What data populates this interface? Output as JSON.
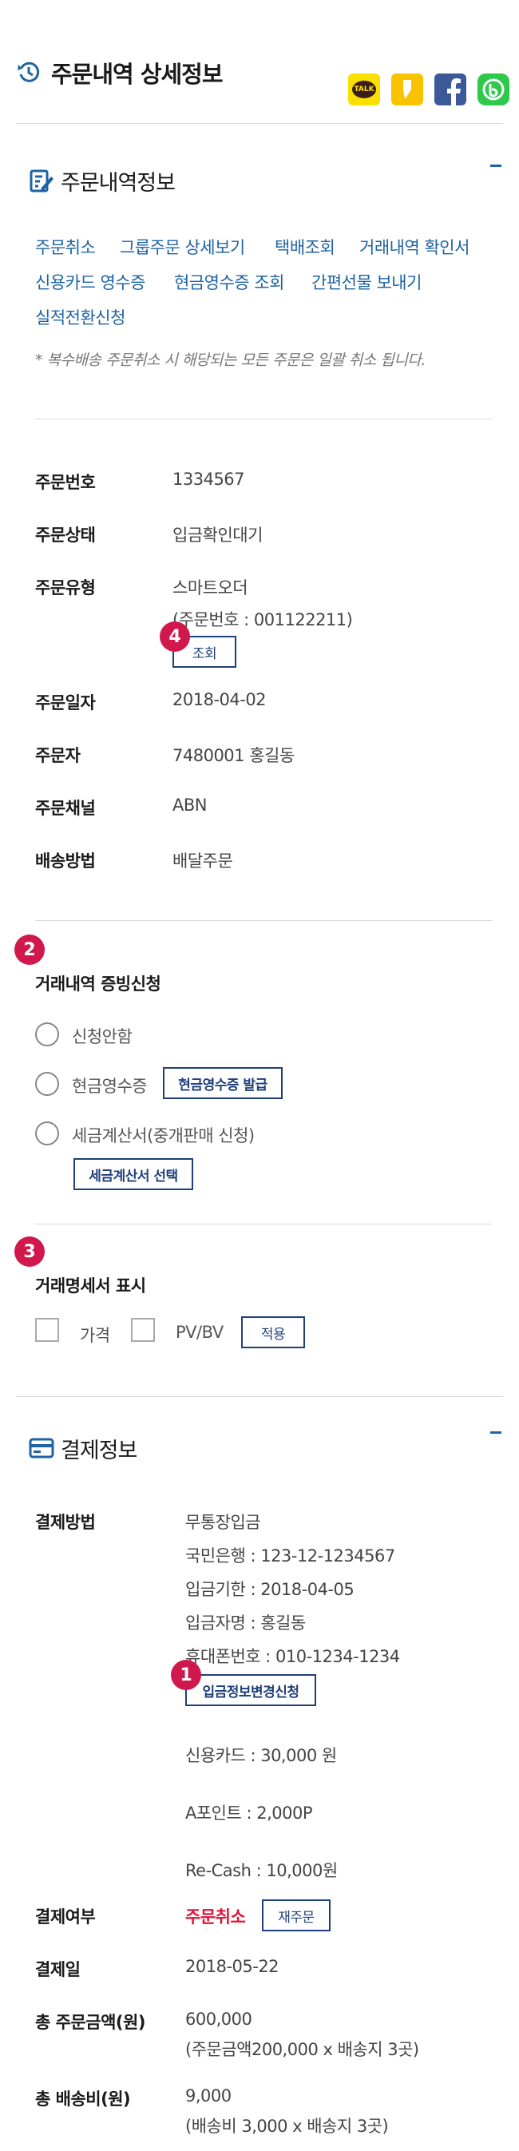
{
  "header": {
    "title": "주문내역 상세정보",
    "share": {
      "kakaotalk_text": "TALK"
    }
  },
  "order_info": {
    "section_title": "주문내역정보",
    "links": [
      "주문취소",
      "그룹주문 상세보기",
      "택배조회",
      "거래내역 확인서",
      "신용카드 영수증",
      "현금영수증 조회",
      "간편선물 보내기",
      "실적전환신청"
    ],
    "note": "* 복수배송 주문취소 시 해당되는 모든 주문은 일괄 취소 됩니다.",
    "fields": {
      "order_no_label": "주문번호",
      "order_no": "1334567",
      "status_label": "주문상태",
      "status": "입금확인대기",
      "type_label": "주문유형",
      "type": "스마트오더",
      "type_sub": "(주문번호 : 001122211)",
      "type_button": "조회",
      "date_label": "주문일자",
      "date": "2018-04-02",
      "orderer_label": "주문자",
      "orderer": "7480001 홍길동",
      "channel_label": "주문채널",
      "channel": "ABN",
      "delivery_label": "배송방법",
      "delivery": "배달주문"
    }
  },
  "badges": {
    "b1": "1",
    "b2": "2",
    "b3": "3",
    "b4": "4"
  },
  "proof": {
    "title": "거래내역 증빙신청",
    "options": [
      "신청안함",
      "현금영수증",
      "세금계산서(중개판매 신청)"
    ],
    "cash_receipt_button": "현금영수증 발급",
    "tax_invoice_button": "세금계산서 선택"
  },
  "statement": {
    "title": "거래명세서 표시",
    "options": [
      "가격",
      "PV/BV"
    ],
    "apply_button": "적용"
  },
  "payment": {
    "section_title": "결제정보",
    "method_label": "결제방법",
    "method_lines": [
      "무통장입금",
      "국민은행 : 123-12-1234567",
      "입금기한 : 2018-04-05",
      "입금자명 : 홍길동",
      "휴대폰번호 : 010-1234-1234"
    ],
    "change_button": "입금정보변경신청",
    "credit_card": "신용카드 : 30,000 원",
    "a_point": "A포인트 : 2,000P",
    "re_cash": "Re-Cash : 10,000원",
    "paid_label": "결제여부",
    "paid_status": "주문취소",
    "reorder_button": "재주문",
    "pay_date_label": "결제일",
    "pay_date": "2018-05-22",
    "total_label": "총 주문금액(원)",
    "total": "600,000",
    "total_sub": "(주문금액200,000 x 배송지 3곳)",
    "shipping_label": "총 배송비(원)",
    "shipping": "9,000",
    "shipping_sub": "(배송비 3,000 x 배송지 3곳)"
  },
  "colors": {
    "accent": "#1e63a4",
    "badge": "#d0184c",
    "cancel": "#e0143c",
    "button_border": "#1f3f7a"
  }
}
